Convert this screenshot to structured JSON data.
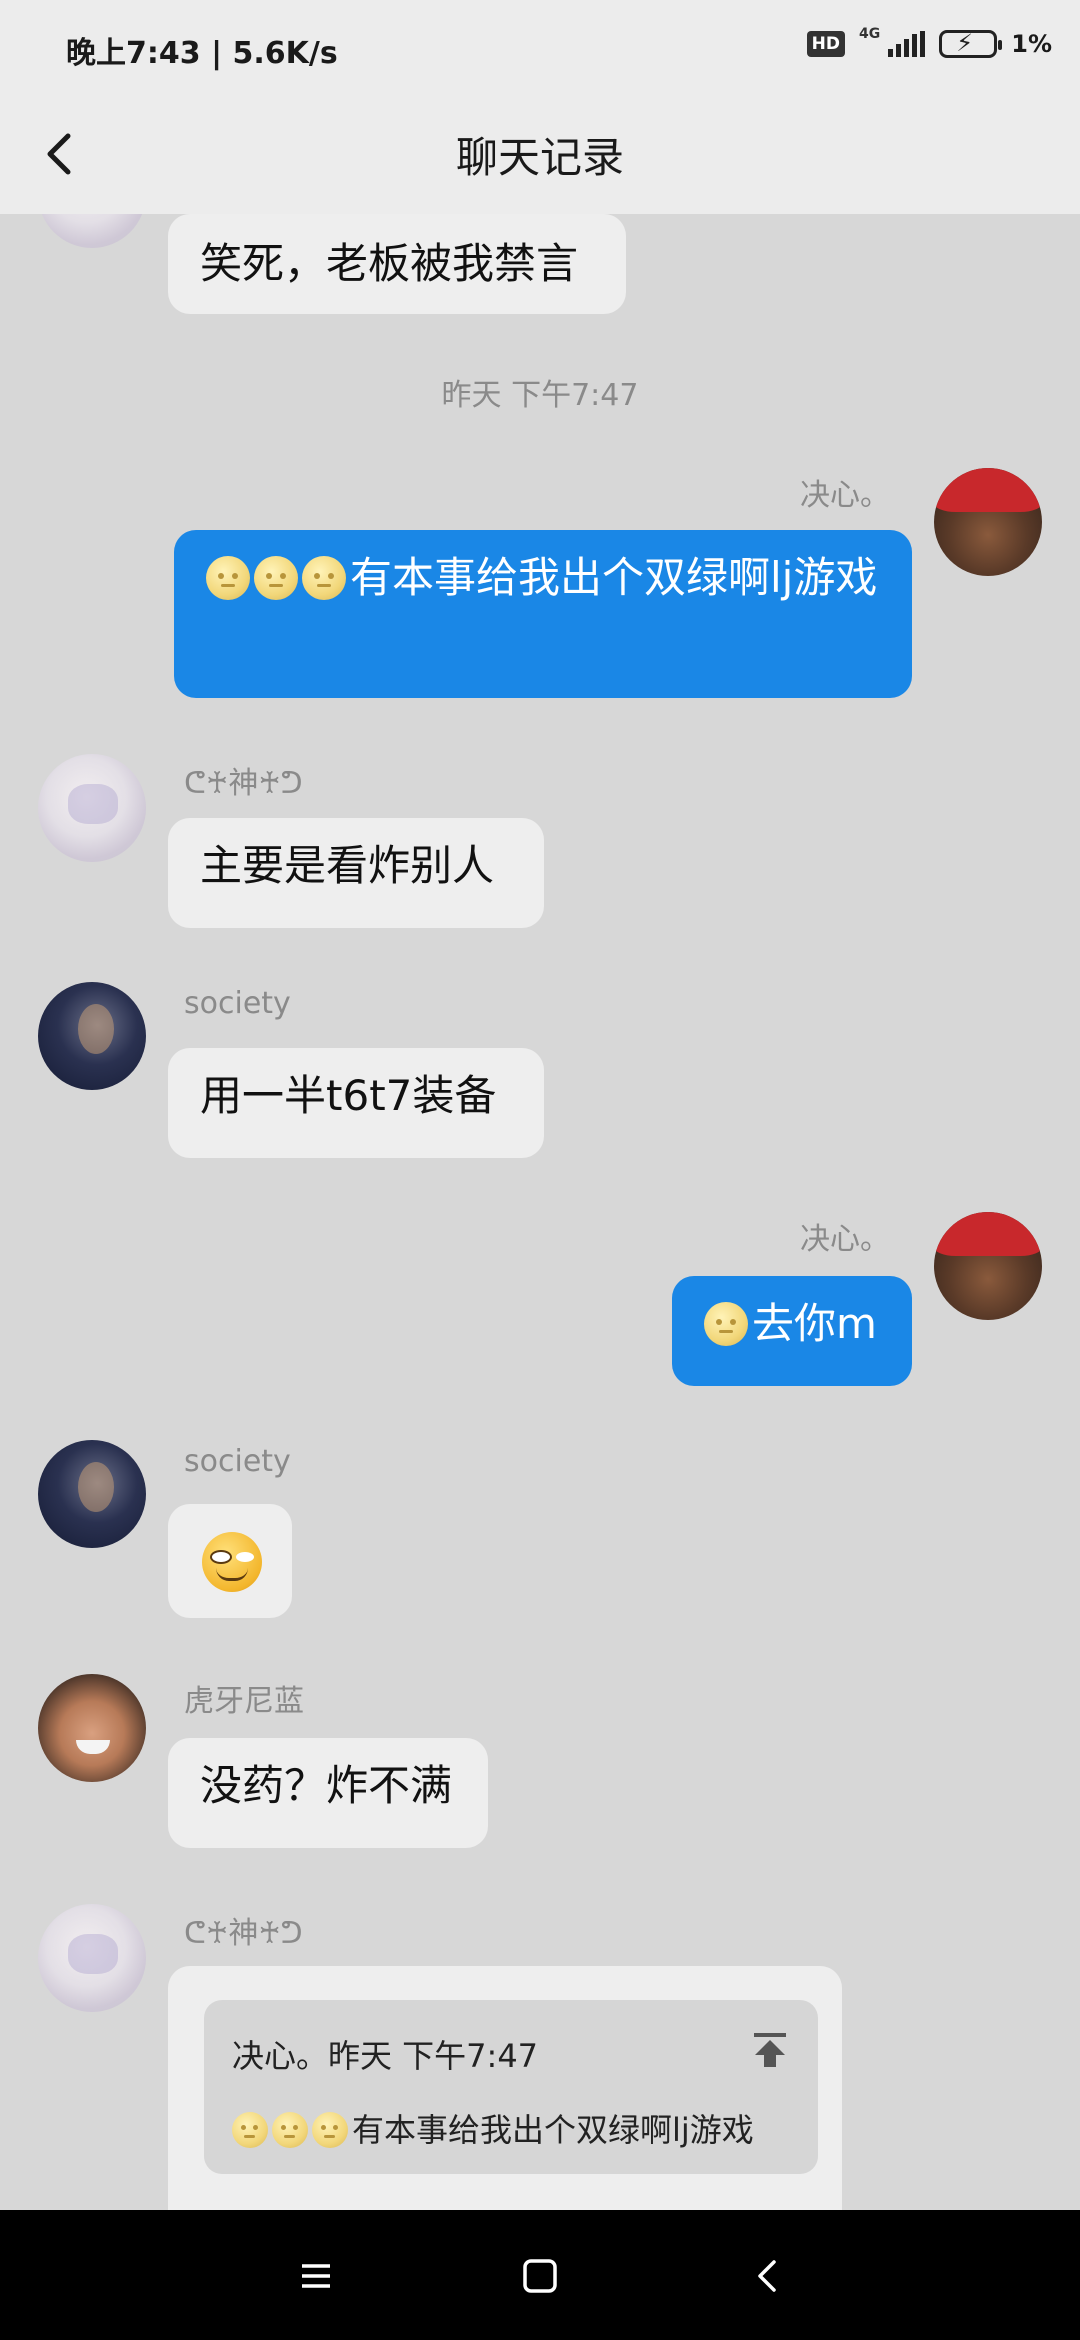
{
  "status_bar": {
    "time": "晚上7:43 | 5.6K/s",
    "hd": "HD",
    "network": "4G",
    "battery": "1%"
  },
  "header": {
    "title": "聊天记录"
  },
  "messages": [
    {
      "text": "笑死，老板被我禁言"
    },
    {
      "timestamp": "昨天 下午7:47"
    },
    {
      "sender": "决心。",
      "text": "有本事给我出个双绿啊lj游戏"
    },
    {
      "sender": "ᕦ♰神♰ᕤ",
      "text": "主要是看炸别人"
    },
    {
      "sender": "society",
      "text": "用一半t6t7装备"
    },
    {
      "sender": "决心。",
      "text": "去你m"
    },
    {
      "sender": "society",
      "emoji": "smirk-emoji"
    },
    {
      "sender": "虎牙尼蓝",
      "text": "没药？炸不满"
    },
    {
      "sender": "ᕦ♰神♰ᕤ",
      "quote": {
        "header": "决心。昨天 下午7:47",
        "text": "有本事给我出个双绿啊lj游戏"
      }
    }
  ],
  "colors": {
    "accent": "#1a87e6",
    "background": "#d7d7d7",
    "bubble_left": "#eeeeee"
  }
}
